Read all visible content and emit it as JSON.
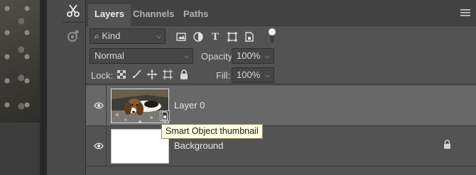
{
  "tabs": [
    {
      "label": "Layers",
      "active": true
    },
    {
      "label": "Channels",
      "active": false
    },
    {
      "label": "Paths",
      "active": false
    }
  ],
  "filter": {
    "kind_label": "Kind",
    "icons": [
      "image-filter-icon",
      "adjustment-filter-icon",
      "type-filter-icon",
      "shape-filter-icon",
      "smart-object-filter-icon"
    ],
    "filter_on": true
  },
  "blend": {
    "mode": "Normal",
    "opacity_label": "Opacity:",
    "opacity_value": "100%",
    "lock_label": "Lock:",
    "fill_label": "Fill:",
    "fill_value": "100%"
  },
  "layers": [
    {
      "name": "Layer 0",
      "visible": true,
      "selected": true,
      "smart_object": true,
      "locked": false
    },
    {
      "name": "Background",
      "visible": true,
      "selected": false,
      "smart_object": false,
      "locked": true
    }
  ],
  "tooltip": "Smart Object thumbnail",
  "colors": {
    "panel": "#535353",
    "selected_row": "#686868",
    "tooltip_bg": "#fefde0"
  }
}
